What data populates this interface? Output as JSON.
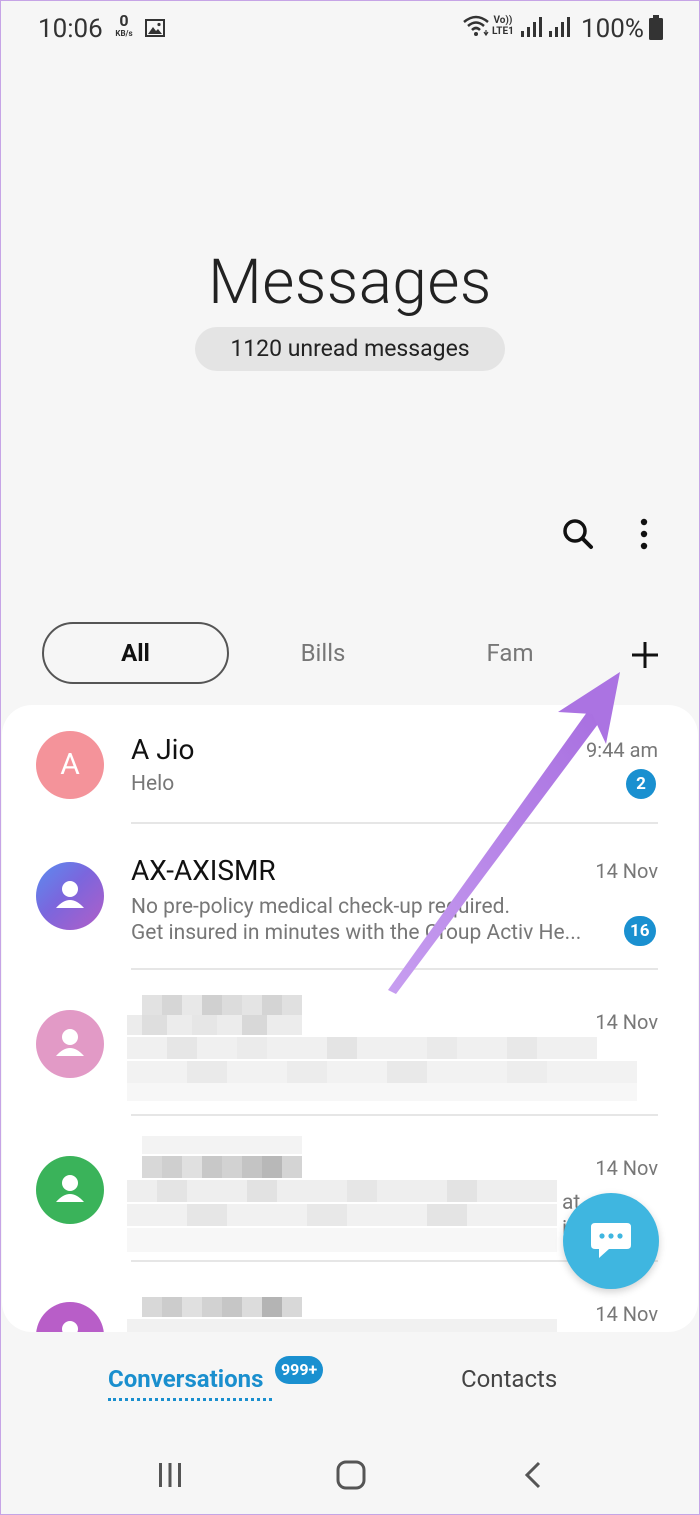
{
  "status_bar": {
    "time": "10:06",
    "net_speed_value": "0",
    "net_speed_unit": "KB/s",
    "volte_top": "Vo))",
    "volte_bottom": "LTE1",
    "battery": "100%"
  },
  "header": {
    "title": "Messages",
    "unread_summary": "1120 unread messages"
  },
  "category_tabs": [
    {
      "label": "All",
      "selected": true
    },
    {
      "label": "Bills",
      "selected": false
    },
    {
      "label": "Fam",
      "selected": false
    }
  ],
  "conversations": [
    {
      "name": "A Jio",
      "time": "9:44 am",
      "preview": [
        "Helo"
      ],
      "unread": "2",
      "avatar_letter": "A",
      "avatar_color": "#f4939a"
    },
    {
      "name": "AX-AXISMR",
      "time": "14 Nov",
      "preview": [
        "No pre-policy medical check-up required.",
        "Get insured in minutes with the Group Activ He..."
      ],
      "unread": "16",
      "avatar_color": "#7b66dd"
    },
    {
      "name": "",
      "time": "14 Nov",
      "preview": [],
      "unread": "",
      "avatar_color": "#e29ac6"
    },
    {
      "name": "",
      "time": "14 Nov",
      "preview": [],
      "unread": "",
      "avatar_color": "#3ab35a",
      "preview_fragment_1": "at",
      "preview_fragment_2": "i"
    },
    {
      "name": "",
      "time": "14 Nov",
      "preview": [],
      "unread": "",
      "avatar_color": "#b85ec8"
    }
  ],
  "bottom_tabs": {
    "conversations": "Conversations",
    "conversations_badge": "999+",
    "contacts": "Contacts"
  },
  "icons": {
    "search": "search-icon",
    "more": "more-vertical-icon",
    "add": "plus-icon",
    "compose": "chat-bubble-icon",
    "nav_recents": "recents-icon",
    "nav_home": "home-icon",
    "nav_back": "back-icon"
  },
  "colors": {
    "accent": "#1a8fce",
    "fab": "#3fb6e0",
    "annotation": "#b57ee6"
  }
}
